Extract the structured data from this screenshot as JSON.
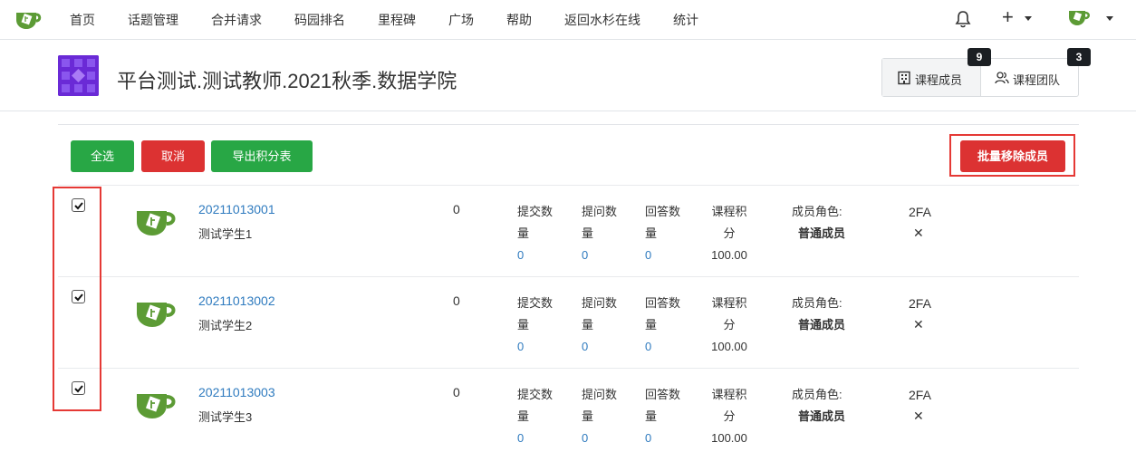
{
  "nav": {
    "items": [
      "首页",
      "话题管理",
      "合并请求",
      "码园排名",
      "里程碑",
      "广场",
      "帮助",
      "返回水杉在线",
      "统计"
    ],
    "plus": "+"
  },
  "header": {
    "title": "平台测试.测试教师.2021秋季.数据学院",
    "tabs": [
      {
        "label": "课程成员",
        "count": "9"
      },
      {
        "label": "课程团队",
        "count": "3"
      }
    ]
  },
  "toolbar": {
    "select_all": "全选",
    "cancel": "取消",
    "export": "导出积分表",
    "batch_remove": "批量移除成员"
  },
  "row_labels": {
    "submit": [
      "提交数",
      "量"
    ],
    "ask": [
      "提问数",
      "量"
    ],
    "answer": [
      "回答数",
      "量"
    ],
    "score": [
      "课程积",
      "分"
    ],
    "role": "成员角色:",
    "twofa": "2FA",
    "twofa_status": "✕"
  },
  "members": [
    {
      "id": "20211013001",
      "name": "测试学生1",
      "zero": "0",
      "submit": "0",
      "ask": "0",
      "answer": "0",
      "score": "100.00",
      "role": "普通成员",
      "checked": true
    },
    {
      "id": "20211013002",
      "name": "测试学生2",
      "zero": "0",
      "submit": "0",
      "ask": "0",
      "answer": "0",
      "score": "100.00",
      "role": "普通成员",
      "checked": true
    },
    {
      "id": "20211013003",
      "name": "测试学生3",
      "zero": "0",
      "submit": "0",
      "ask": "0",
      "answer": "0",
      "score": "100.00",
      "role": "普通成员",
      "checked": true
    }
  ],
  "colors": {
    "green": "#28a745",
    "red": "#dc3232",
    "link": "#2f7bbf",
    "brand": "#5c9b35",
    "course_icon": "#6a2ad6"
  }
}
